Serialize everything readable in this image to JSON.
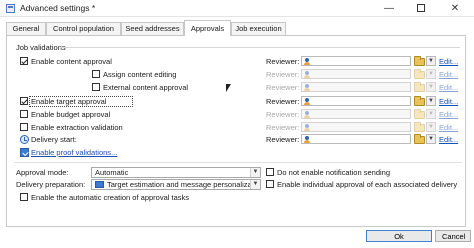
{
  "window": {
    "title": "Advanced settings *",
    "minimize": "—",
    "close": "✕"
  },
  "tabs": [
    {
      "label": "General"
    },
    {
      "label": "Control population"
    },
    {
      "label": "Seed addresses"
    },
    {
      "label": "Approvals"
    },
    {
      "label": "Job execution"
    }
  ],
  "active_tab": "Approvals",
  "job_validations": {
    "title": "Job validations",
    "reviewer_label": "Reviewer:",
    "edit_label": "Edit...",
    "dropdown_glyph": "▼",
    "rows": [
      {
        "label": "Enable content approval",
        "checked": true,
        "enabled": true
      },
      {
        "label": "Assign content editing",
        "checked": false,
        "enabled": false
      },
      {
        "label": "External content approval",
        "checked": false,
        "enabled": false
      },
      {
        "label": "Enable target approval",
        "checked": true,
        "enabled": true
      },
      {
        "label": "Enable budget approval",
        "checked": false,
        "enabled": true
      },
      {
        "label": "Enable extraction validation",
        "checked": false,
        "enabled": true
      },
      {
        "label": "Delivery start:",
        "checked": false,
        "enabled": true
      }
    ],
    "proof_link": "Enable proof validations..."
  },
  "approval": {
    "mode_label": "Approval mode:",
    "mode_value": "Automatic",
    "prep_label": "Delivery preparation:",
    "prep_value": "Target estimation and message personalizat",
    "no_notification": "Do not enable notification sending",
    "individual_approval": "Enable individual approval of each associated delivery",
    "auto_tasks": "Enable the automatic creation of approval tasks"
  },
  "buttons": {
    "ok": "Ok",
    "cancel": "Cancel"
  },
  "colors": {
    "link": "#1a4fb8",
    "folder": "#e7c35a",
    "accent": "#3d7fd1"
  }
}
